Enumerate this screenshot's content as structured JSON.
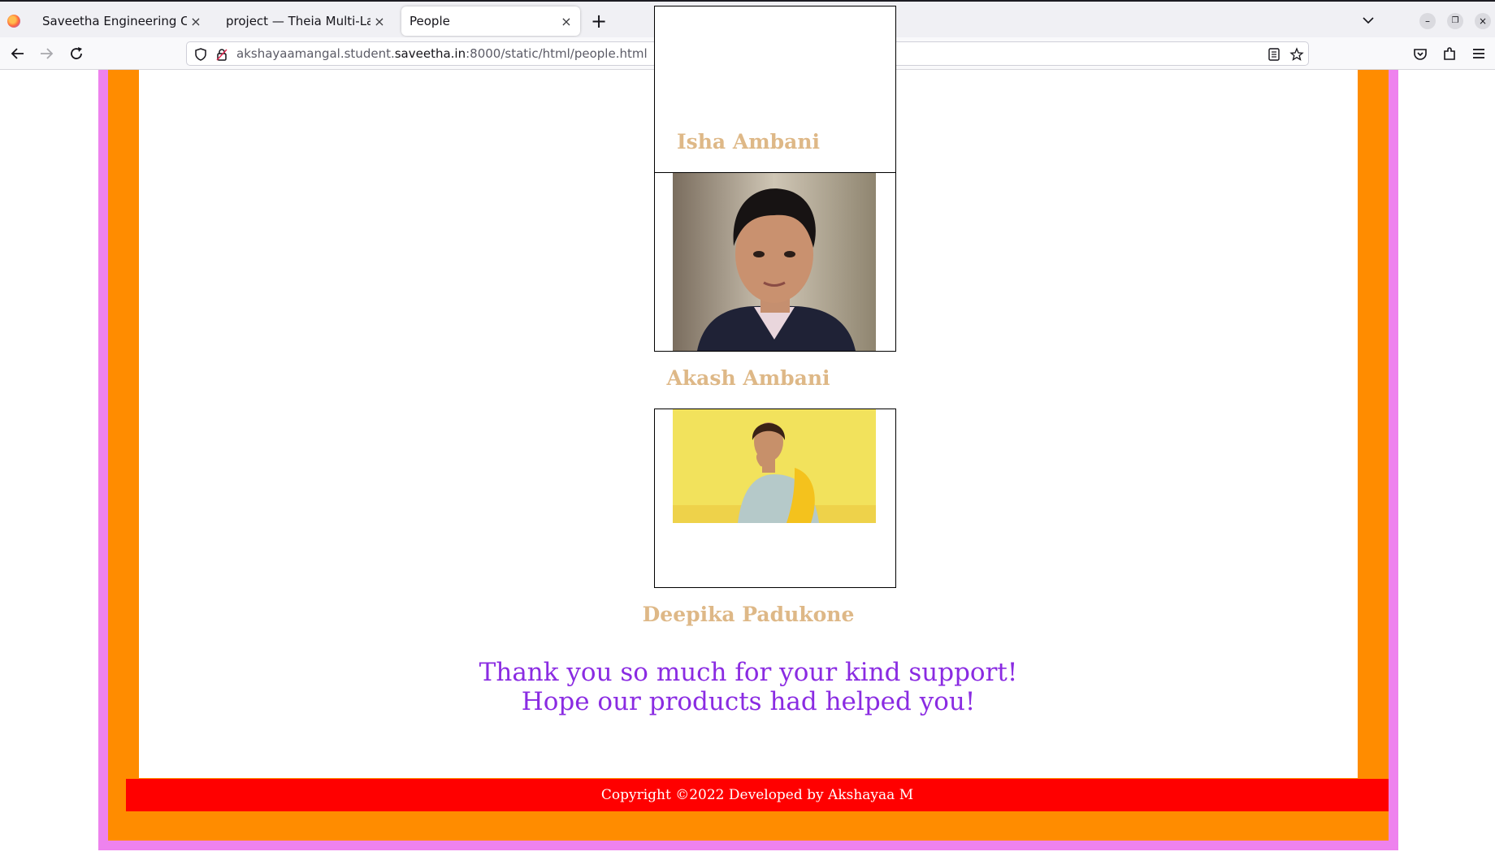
{
  "browser": {
    "tabs": [
      {
        "label": "Saveetha Engineering Colleg",
        "active": false
      },
      {
        "label": "project — Theia Multi-Langu",
        "active": false
      },
      {
        "label": "People",
        "active": true
      }
    ],
    "url": {
      "prefix": "akshayaamangal.student.",
      "host": "saveetha.in",
      "suffix": ":8000/static/html/people.html"
    }
  },
  "page": {
    "people": [
      {
        "name": "Isha Ambani"
      },
      {
        "name": "Akash Ambani"
      },
      {
        "name": "Deepika Padukone"
      }
    ],
    "thanks_line1": "Thank you so much for your kind support!",
    "thanks_line2": "Hope our products had helped you!",
    "footer": "Copyright ©2022 Developed by Akshayaa M"
  },
  "colors": {
    "border_outer": "#ee82ee",
    "border_inner": "#ff8c00",
    "name_color": "#deb887",
    "thanks_color": "#8a2be2",
    "footer_bg": "#ff0000"
  },
  "icons": [
    "firefox-logo-icon",
    "close-icon",
    "plus-icon",
    "chevron-down-icon",
    "minimize-icon",
    "restore-icon",
    "back-icon",
    "forward-icon",
    "reload-icon",
    "shield-icon",
    "lock-icon",
    "reader-view-icon",
    "star-icon",
    "pocket-icon",
    "extensions-icon",
    "menu-icon"
  ]
}
